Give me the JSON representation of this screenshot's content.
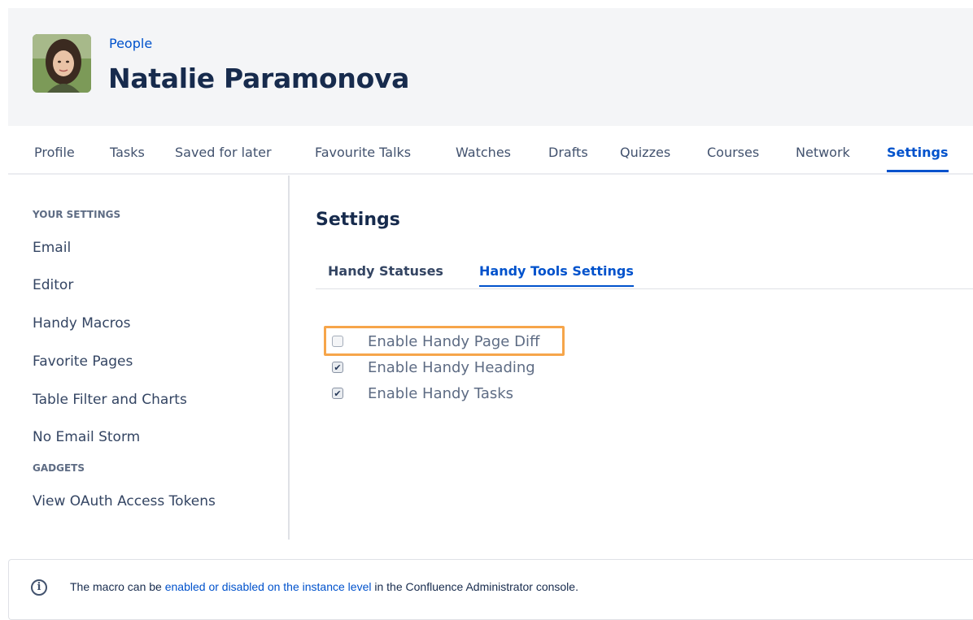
{
  "header": {
    "breadcrumb": "People",
    "user_name": "Natalie Paramonova"
  },
  "nav_tabs": [
    {
      "label": "Profile",
      "active": false
    },
    {
      "label": "Tasks",
      "active": false
    },
    {
      "label": "Saved for later",
      "active": false
    },
    {
      "label": "Favourite Talks",
      "active": false
    },
    {
      "label": "Watches",
      "active": false
    },
    {
      "label": "Drafts",
      "active": false
    },
    {
      "label": "Quizzes",
      "active": false
    },
    {
      "label": "Courses",
      "active": false
    },
    {
      "label": "Network",
      "active": false
    },
    {
      "label": "Settings",
      "active": true
    }
  ],
  "sidebar": {
    "section_your_settings": "YOUR SETTINGS",
    "items": [
      "Email",
      "Editor",
      "Handy Macros",
      "Favorite Pages",
      "Table Filter and Charts",
      "No Email Storm"
    ],
    "section_gadgets": "GADGETS",
    "gadget_items": [
      "View OAuth Access Tokens"
    ]
  },
  "main": {
    "title": "Settings",
    "subtabs": [
      {
        "label": "Handy Statuses",
        "active": false
      },
      {
        "label": "Handy Tools Settings",
        "active": true
      }
    ],
    "options": [
      {
        "label": "Enable Handy Page Diff",
        "checked": false,
        "highlighted": true
      },
      {
        "label": "Enable Handy Heading",
        "checked": true,
        "highlighted": false
      },
      {
        "label": "Enable Handy Tasks",
        "checked": true,
        "highlighted": false
      }
    ]
  },
  "info_panel": {
    "icon": "info-icon",
    "text_before": "The macro can be ",
    "link_text": "enabled or disabled on the instance level",
    "text_after": " in the Confluence Administrator console."
  },
  "colors": {
    "accent": "#0052cc",
    "highlight": "#f6a54a",
    "header_bg": "#f4f5f7"
  }
}
